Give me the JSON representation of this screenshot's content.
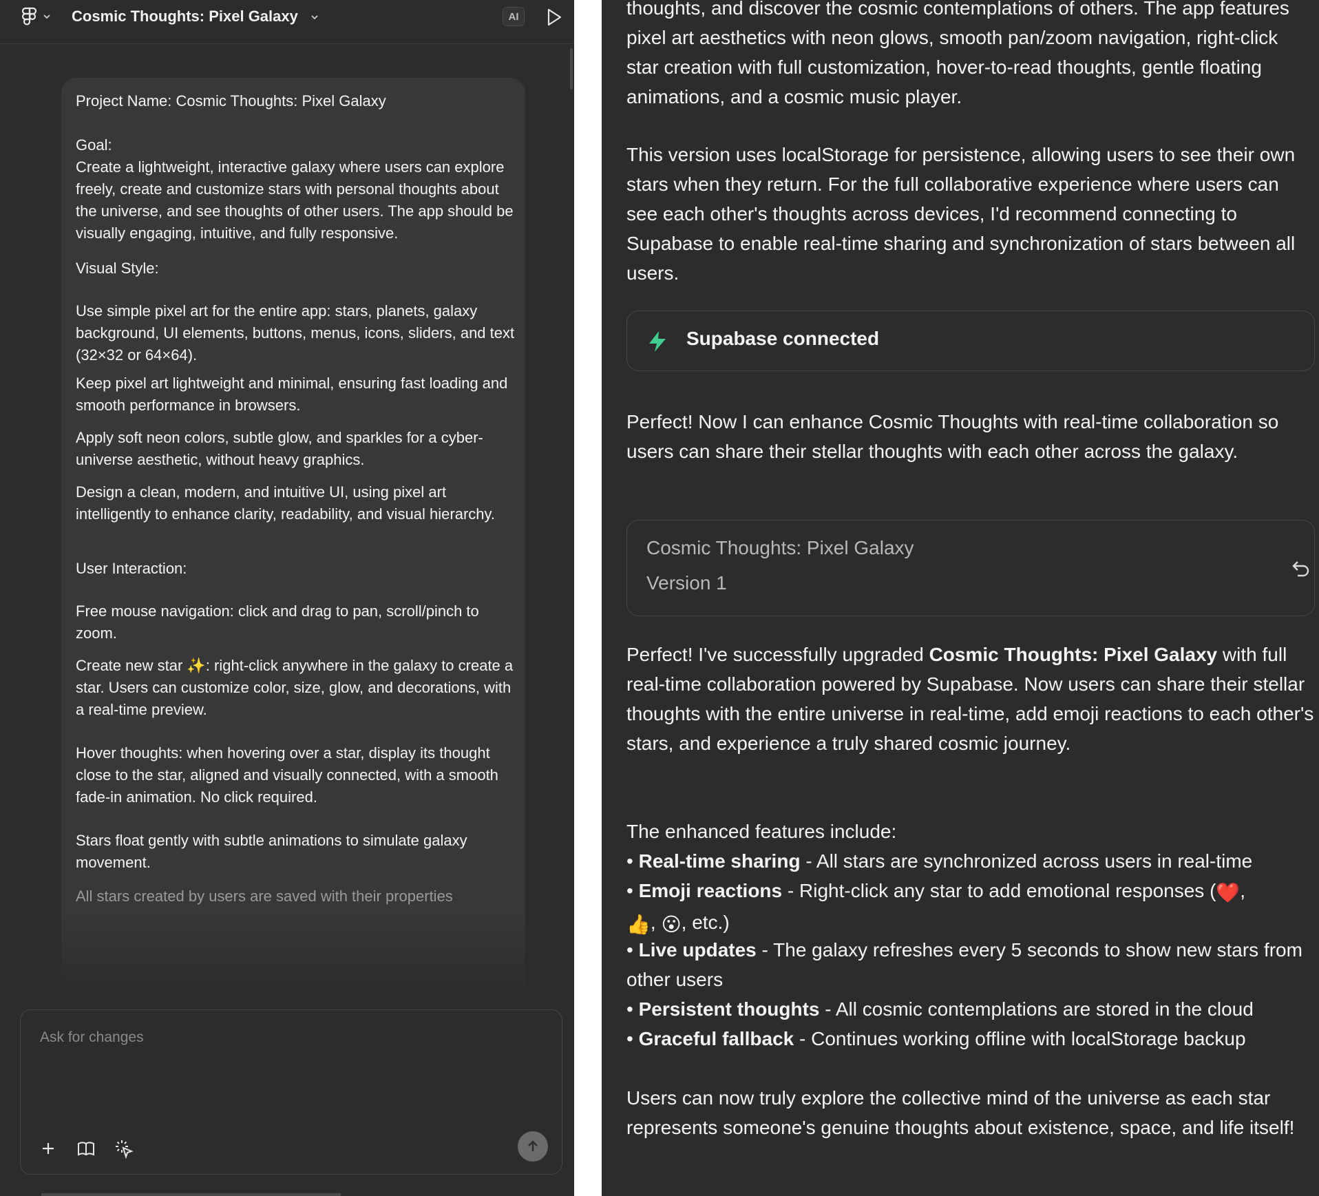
{
  "left": {
    "header": {
      "title": "Cosmic Thoughts: Pixel Galaxy",
      "ai_badge": "AI"
    },
    "prompt": {
      "project_line": "Project Name: Cosmic Thoughts: Pixel Galaxy",
      "goal_heading": "Goal:",
      "goal_text": "Create a lightweight, interactive galaxy where users can explore freely, create and customize stars with personal thoughts about the universe, and see thoughts of other users. The app should be visually engaging, intuitive, and fully responsive.",
      "visual_heading": "Visual Style:",
      "visual_1": "Use simple pixel art for the entire app: stars, planets, galaxy background, UI elements, buttons, menus, icons, sliders, and text (32×32 or 64×64).",
      "visual_2": "Keep pixel art lightweight and minimal, ensuring fast loading and smooth performance in browsers.",
      "visual_3": "Apply soft neon colors, subtle glow, and sparkles for a cyber-universe aesthetic, without heavy graphics.",
      "visual_4": "Design a clean, modern, and intuitive UI, using pixel art intelligently to enhance clarity, readability, and visual hierarchy.",
      "interaction_heading": "User Interaction:",
      "interaction_1": "Free mouse navigation: click and drag to pan, scroll/pinch to zoom.",
      "interaction_2_pre": "Create new star ",
      "interaction_2_emoji": "✨",
      "interaction_2_post": ": right-click anywhere in the galaxy to create a star. Users can customize color, size, glow, and decorations, with a real-time preview.",
      "interaction_3": "Hover thoughts: when hovering over a star, display its thought close to the star, aligned and visually connected, with a smooth fade-in animation. No click required.",
      "interaction_4": "Stars float gently with subtle animations to simulate galaxy movement.",
      "cutoff": "All stars created by users are saved with their properties"
    },
    "composer": {
      "placeholder": "Ask for changes"
    }
  },
  "right": {
    "intro_text": "thoughts, and discover the cosmic contemplations of others. The app features pixel art aesthetics with neon glows, smooth pan/zoom navigation, right-click star creation with full customization, hover-to-read thoughts, gentle floating animations, and a cosmic music player.",
    "localstorage_text": "This version uses localStorage for persistence, allowing users to see their own stars when they return. For the full collaborative experience where users can see each other's thoughts across devices, I'd recommend connecting to Supabase to enable real-time sharing and synchronization of stars between all users.",
    "supabase_label": "Supabase connected",
    "perfect_text": "Perfect! Now I can enhance Cosmic Thoughts with real-time collaboration so users can share their stellar thoughts with each other across the galaxy.",
    "version_card": {
      "title": "Cosmic Thoughts: Pixel Galaxy",
      "version": "Version 1"
    },
    "upgrade": {
      "pre": "Perfect! I've successfully upgraded ",
      "bold": "Cosmic Thoughts: Pixel Galaxy",
      "post": " with full real-time collaboration powered by Supabase. Now users can share their stellar thoughts with the entire universe in real-time, add emoji reactions to each other's stars, and experience a truly shared cosmic journey."
    },
    "features_heading": "The enhanced features include:",
    "features": [
      {
        "bullet": "•",
        "name": "Real-time sharing",
        "sep": " - ",
        "desc": "All stars are synchronized across users in real-time"
      },
      {
        "bullet": "•",
        "name": "Emoji reactions",
        "sep": " - ",
        "desc_pre": "Right-click any star to add emotional responses (",
        "emoji_1": "❤️",
        "emoji_2": "👍",
        "emoji_3": "😮",
        "desc_post": ", etc.)"
      },
      {
        "bullet": "•",
        "name": "Live updates",
        "sep": " - ",
        "desc": "The galaxy refreshes every 5 seconds to show new stars from other users"
      },
      {
        "bullet": "•",
        "name": "Persistent thoughts",
        "sep": " - ",
        "desc": "All cosmic contemplations are stored in the cloud"
      },
      {
        "bullet": "•",
        "name": "Graceful fallback",
        "sep": " - ",
        "desc": "Continues working offline with localStorage backup"
      }
    ],
    "closing_text": "Users can now truly explore the collective mind of the universe as each star represents someone's genuine thoughts about existence, space, and life itself!"
  },
  "colors": {
    "panel_bg": "#2c2c2c",
    "card_bg": "#383838",
    "text": "#f4f4f4",
    "muted": "#b8b8b8",
    "supabase_green": "#3ecf8e"
  }
}
